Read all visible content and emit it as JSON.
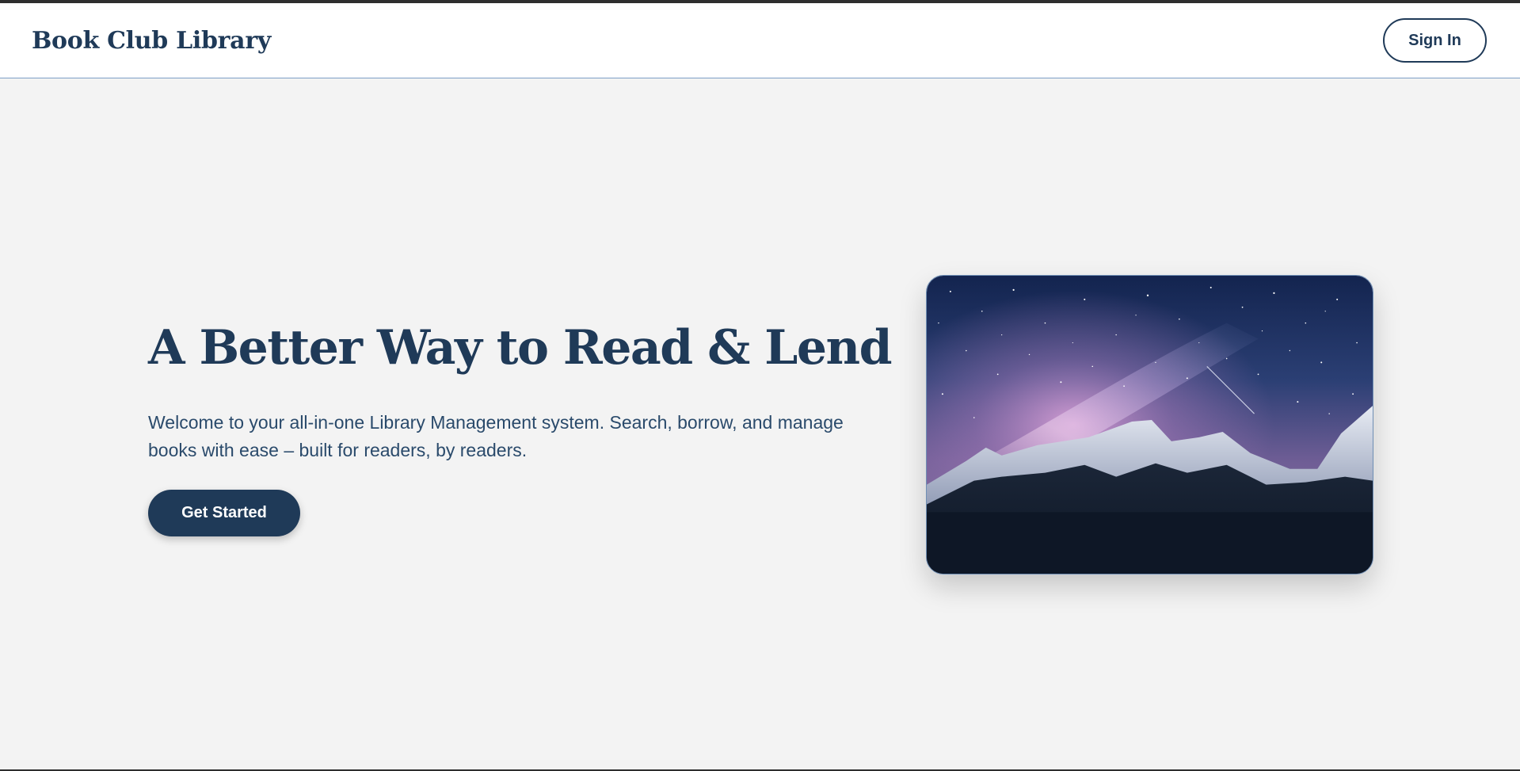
{
  "navbar": {
    "brand": "Book Club Library",
    "signin_label": "Sign In"
  },
  "hero": {
    "title": "A Better Way to Read & Lend",
    "subtitle": "Welcome to your all-in-one Library Management system. Search, borrow, and manage books with ease – built for readers, by readers.",
    "cta_label": "Get Started",
    "image_subject": "night-sky-milky-way-mountains"
  },
  "colors": {
    "primary": "#1f3a58",
    "background": "#f3f3f3",
    "navbar_bg": "#ffffff",
    "navbar_border": "#7d9fc6"
  }
}
